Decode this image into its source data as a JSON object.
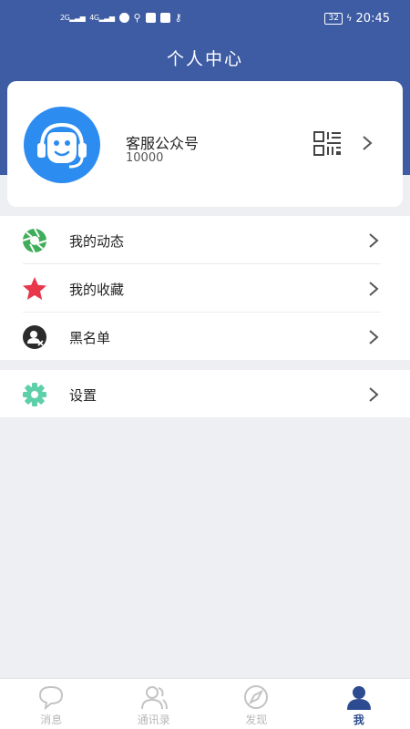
{
  "status_bar": {
    "network_1": "2G",
    "network_2": "4G",
    "battery": "32",
    "time": "20:45"
  },
  "header": {
    "title": "个人中心"
  },
  "profile": {
    "name": "客服公众号",
    "id": "10000"
  },
  "menu": {
    "items": [
      {
        "label": "我的动态",
        "icon": "aperture-icon"
      },
      {
        "label": "我的收藏",
        "icon": "star-icon"
      },
      {
        "label": "黑名单",
        "icon": "blocked-user-icon"
      }
    ],
    "settings": {
      "label": "设置",
      "icon": "gear-icon"
    }
  },
  "tabbar": {
    "tabs": [
      {
        "label": "消息",
        "icon": "chat-bubble-icon"
      },
      {
        "label": "通讯录",
        "icon": "contacts-icon"
      },
      {
        "label": "发现",
        "icon": "compass-icon"
      },
      {
        "label": "我",
        "icon": "person-icon",
        "active": true
      }
    ]
  },
  "colors": {
    "header": "#3e5ca3",
    "avatar": "#2d8cf0",
    "aperture": "#3fae5a",
    "star": "#e8364b",
    "settings": "#5ecfa8",
    "tab_active": "#2c4b90"
  }
}
